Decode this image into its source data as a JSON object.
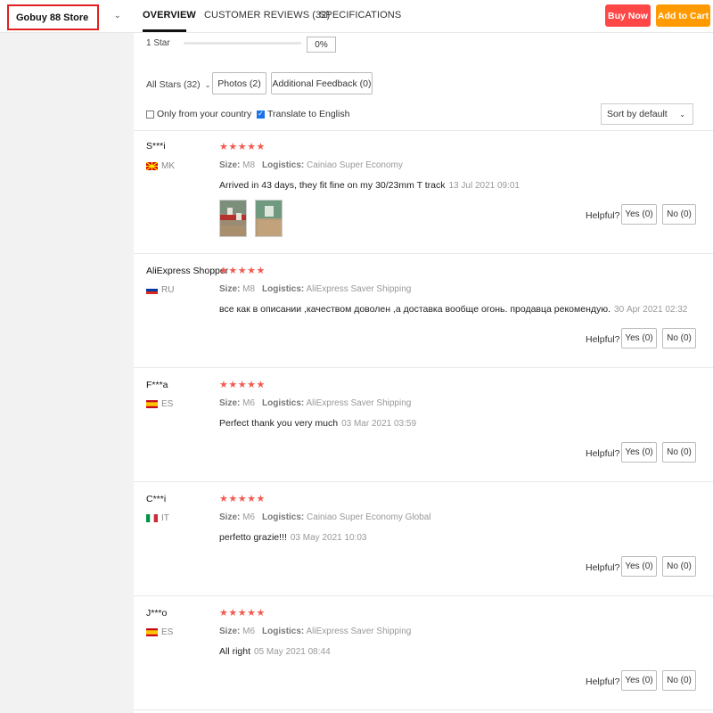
{
  "header": {
    "store_name": "Gobuy 88 Store",
    "tabs": [
      "OVERVIEW",
      "CUSTOMER REVIEWS (32)",
      "SPECIFICATIONS"
    ],
    "buy_now": "Buy Now",
    "add_to_cart": "Add to Cart"
  },
  "rating_summary": {
    "label": "1 Star",
    "percent_text": "0%",
    "percent_value": 0
  },
  "filters": {
    "all_stars": "All Stars (32)",
    "photos": "Photos (2)",
    "additional_feedback": "Additional Feedback (0)",
    "only_country": "Only from your country",
    "only_country_checked": false,
    "translate": "Translate to English",
    "translate_checked": true,
    "sort": "Sort by default"
  },
  "labels": {
    "size": "Size:",
    "logistics": "Logistics:",
    "helpful": "Helpful?",
    "yes": "Yes (0)",
    "no": "No (0)"
  },
  "reviews": [
    {
      "name": "S***i",
      "country": "MK",
      "stars": "★★★★★",
      "rating": 5,
      "size": "M8",
      "logistics": "Cainiao Super Economy",
      "text": "Arrived in 43 days, they fit fine on my 30/23mm T track",
      "date": "13 Jul 2021 09:01"
    },
    {
      "name": "AliExpress Shopper",
      "country": "RU",
      "stars": "★★★★★",
      "rating": 5,
      "size": "M8",
      "logistics": "AliExpress Saver Shipping",
      "text": "все как в описании ,качеством доволен ,а доставка вообще огонь. продавца рекомендую.",
      "date": "30 Apr 2021 02:32"
    },
    {
      "name": "F***a",
      "country": "ES",
      "stars": "★★★★★",
      "rating": 5,
      "size": "M6",
      "logistics": "AliExpress Saver Shipping",
      "text": "Perfect thank you very much",
      "date": "03 Mar 2021 03:59"
    },
    {
      "name": "C***i",
      "country": "IT",
      "stars": "★★★★★",
      "rating": 5,
      "size": "M6",
      "logistics": "Cainiao Super Economy Global",
      "text": "perfetto grazie!!!",
      "date": "03 May 2021 10:03"
    },
    {
      "name": "J***o",
      "country": "ES",
      "stars": "★★★★★",
      "rating": 5,
      "size": "M6",
      "logistics": "AliExpress Saver Shipping",
      "text": "All right",
      "date": "05 May 2021 08:44"
    }
  ],
  "colors": {
    "buy_now": "#ff4747",
    "add_to_cart": "#ff9a00",
    "stars": "#f25a4f",
    "highlight_box": "#e02020"
  }
}
